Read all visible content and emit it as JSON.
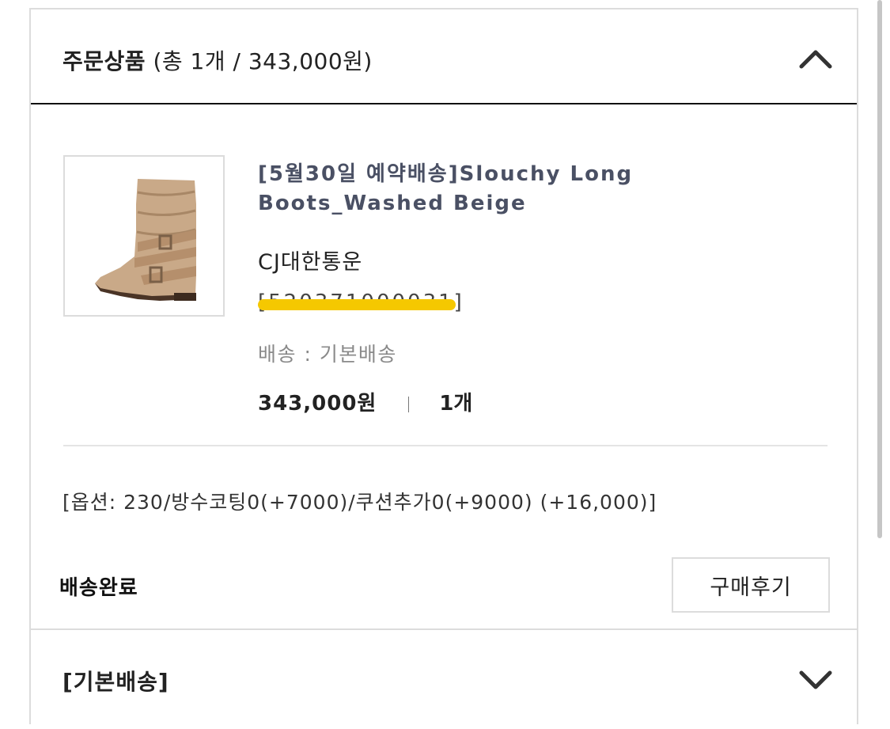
{
  "order_section": {
    "title_bold": "주문상품",
    "title_summary": "(총 1개 / 343,000원)",
    "toggle_icon": "chevron-up-icon"
  },
  "product": {
    "image_icon": "boot-image",
    "name": "[5월30일 예약배송]Slouchy Long Boots_Washed Beige",
    "carrier": "CJ대한통운",
    "tracking_number": "[520371000031]",
    "shipping_method": "배송 : 기본배송",
    "price": "343,000원",
    "quantity": "1개"
  },
  "options": "[옵션: 230/방수코팅0(+7000)/쿠션추가0(+9000) (+16,000)]",
  "status": "배송완료",
  "review_button_label": "구매후기",
  "shipping_section": {
    "title": "[기본배송]",
    "toggle_icon": "chevron-down-icon"
  },
  "colors": {
    "product_name": "#4a5064",
    "redaction_highlight": "#f5c800",
    "header_rule": "#111111",
    "border": "#dcdcdc"
  }
}
